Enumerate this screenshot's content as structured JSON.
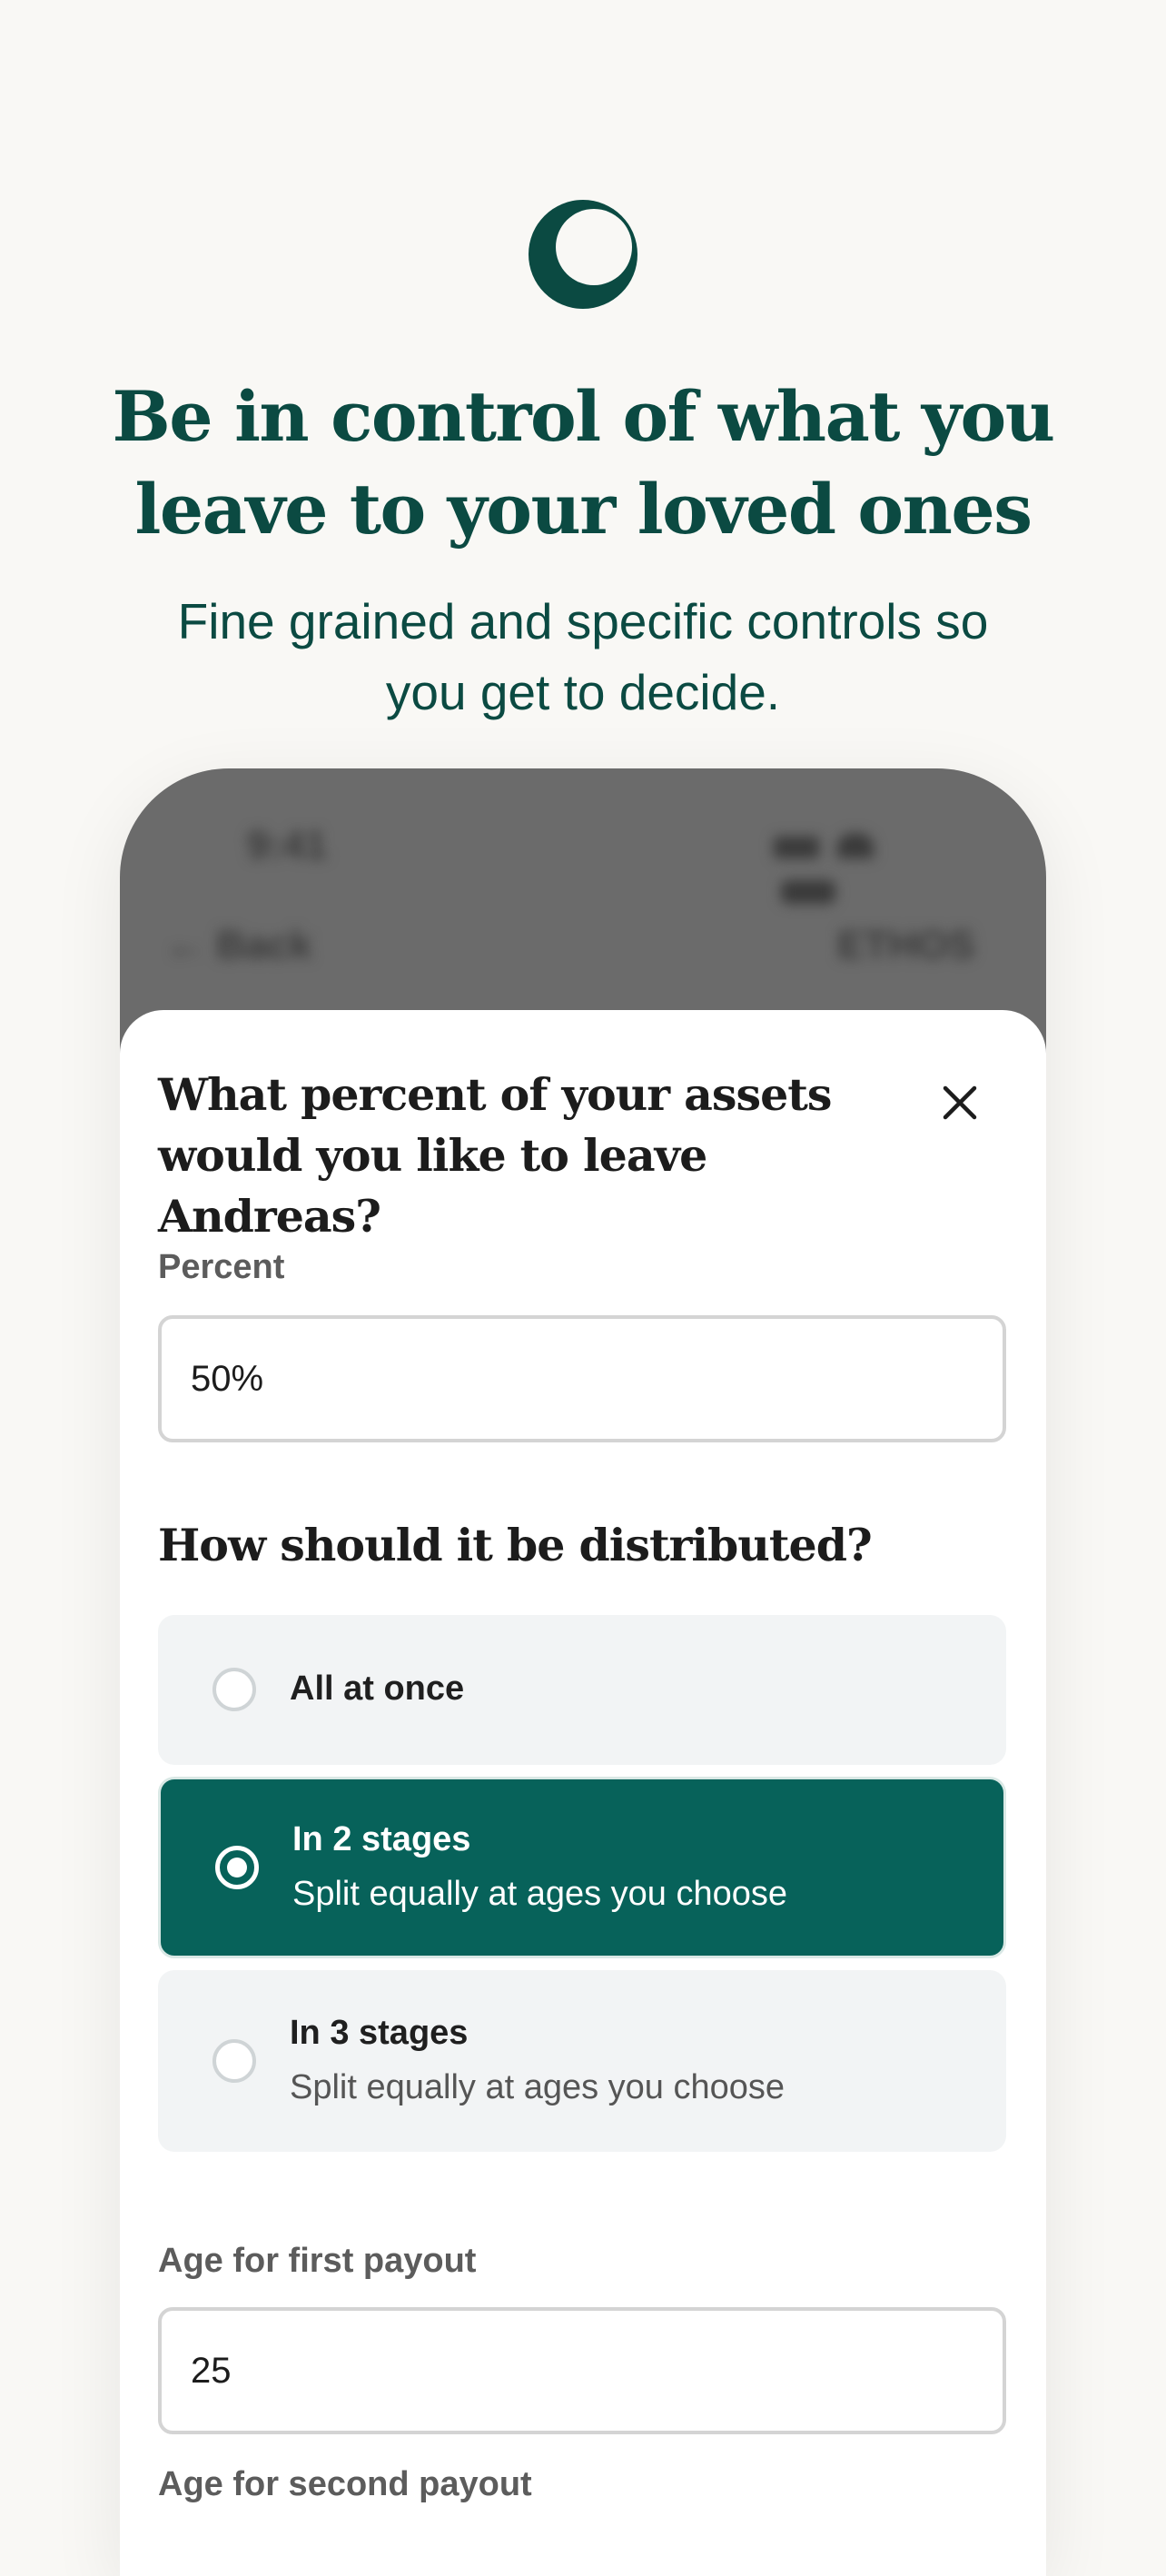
{
  "hero": {
    "logo_icon": "crescent-ring-icon",
    "headline_line1": "Be in control of what you",
    "headline_line2": "leave to your loved ones",
    "subhead_line1": "Fine grained and specific controls so",
    "subhead_line2": "you get to decide."
  },
  "colors": {
    "brand_green": "#0b4a42",
    "selected_option": "#07625a",
    "background": "#f9f8f5"
  },
  "phone": {
    "status_time": "9:41",
    "nav_back": "← Back",
    "nav_right": "ETHOS",
    "sheet": {
      "title_line1": "What percent of your assets",
      "title_line2": "would you like to leave Andreas?",
      "close_icon": "close-icon",
      "percent_label": "Percent",
      "percent_value": "50%",
      "distribution_title": "How should it be distributed?",
      "options": [
        {
          "title": "All at once",
          "subtitle": "",
          "selected": false
        },
        {
          "title": "In 2 stages",
          "subtitle": "Split equally at ages you choose",
          "selected": true
        },
        {
          "title": "In 3 stages",
          "subtitle": "Split equally at ages you choose",
          "selected": false
        }
      ],
      "first_payout_label": "Age for first payout",
      "first_payout_value": "25",
      "second_payout_label": "Age for second payout"
    }
  }
}
